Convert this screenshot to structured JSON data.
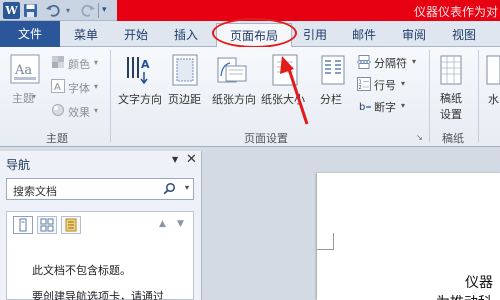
{
  "title_bar": {
    "quick_access": [
      "word-logo-icon",
      "save-icon",
      "undo-icon",
      "redo-icon"
    ],
    "overlay_text": "仪器仪表作为对"
  },
  "tabs": [
    {
      "label": "文件",
      "active": false
    },
    {
      "label": "菜单",
      "active": false
    },
    {
      "label": "开始",
      "active": false
    },
    {
      "label": "插入",
      "active": false
    },
    {
      "label": "页面布局",
      "active": true
    },
    {
      "label": "引用",
      "active": false
    },
    {
      "label": "邮件",
      "active": false
    },
    {
      "label": "审阅",
      "active": false
    },
    {
      "label": "视图",
      "active": false
    }
  ],
  "ribbon": {
    "theme_group": {
      "label": "主题",
      "theme_button": "主题",
      "colors": "颜色",
      "fonts": "字体",
      "effects": "效果"
    },
    "page_setup_group": {
      "label": "页面设置",
      "text_direction": "文字方向",
      "margins": "页边距",
      "orientation": "纸张方向",
      "size": "纸张大小",
      "columns": "分栏",
      "breaks": "分隔符",
      "line_numbers": "行号",
      "hyphenation": "断字"
    },
    "draft_group": {
      "label": "稿纸",
      "draft_settings_line1": "稿纸",
      "draft_settings_line2": "设置"
    },
    "watermark": "水"
  },
  "nav_pane": {
    "title": "导航",
    "search_placeholder": "搜索文档",
    "message_line1": "此文档不包含标题。",
    "message_line2": "要创建导航选项卡，请通过"
  },
  "document": {
    "line1": "仪器",
    "line2": "为推动科"
  },
  "colors": {
    "file_tab": "#2b579a",
    "highlight": "#e31b1b",
    "banner": "#e60012"
  }
}
